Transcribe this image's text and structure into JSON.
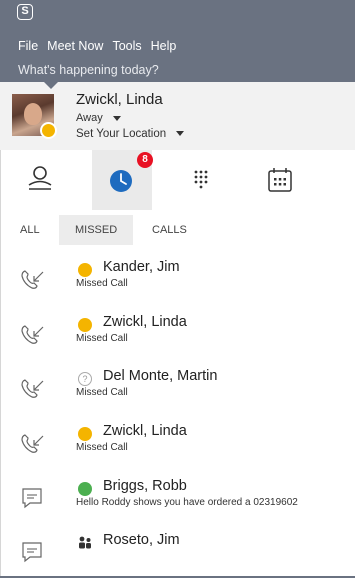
{
  "app": {
    "logo_letter": "S"
  },
  "menu": {
    "items": [
      "File",
      "Meet Now",
      "Tools",
      "Help"
    ]
  },
  "status_message": "What's happening today?",
  "profile": {
    "name": "Zwickl, Linda",
    "presence": "Away",
    "location": "Set Your Location",
    "presence_color": "#f4b400"
  },
  "tabs": [
    {
      "name": "contacts",
      "icon": "person-icon"
    },
    {
      "name": "recent",
      "icon": "clock-icon",
      "badge": "8",
      "active": true
    },
    {
      "name": "dialpad",
      "icon": "dialpad-icon"
    },
    {
      "name": "meetings",
      "icon": "calendar-icon"
    }
  ],
  "filters": [
    "ALL",
    "MISSED",
    "CALLS"
  ],
  "active_filter": "MISSED",
  "conversations": [
    {
      "type": "call",
      "name": "Kander, Jim",
      "sub": "Missed Call",
      "presence": "away"
    },
    {
      "type": "call",
      "name": "Zwickl, Linda",
      "sub": "Missed Call",
      "presence": "away"
    },
    {
      "type": "call",
      "name": "Del Monte, Martin",
      "sub": "Missed Call",
      "presence": "unknown"
    },
    {
      "type": "call",
      "name": "Zwickl, Linda",
      "sub": "Missed Call",
      "presence": "away"
    },
    {
      "type": "message",
      "name": "Briggs, Robb",
      "sub": "Hello  Roddy shows you have ordered a 02319602",
      "presence": "available"
    },
    {
      "type": "message",
      "name": "Roseto, Jim",
      "sub": "",
      "presence": "group"
    }
  ],
  "colors": {
    "accent": "#1e6bbf",
    "titlebar": "#6a7281",
    "away": "#f4b400",
    "available": "#4caf50",
    "badge": "#e81123"
  }
}
